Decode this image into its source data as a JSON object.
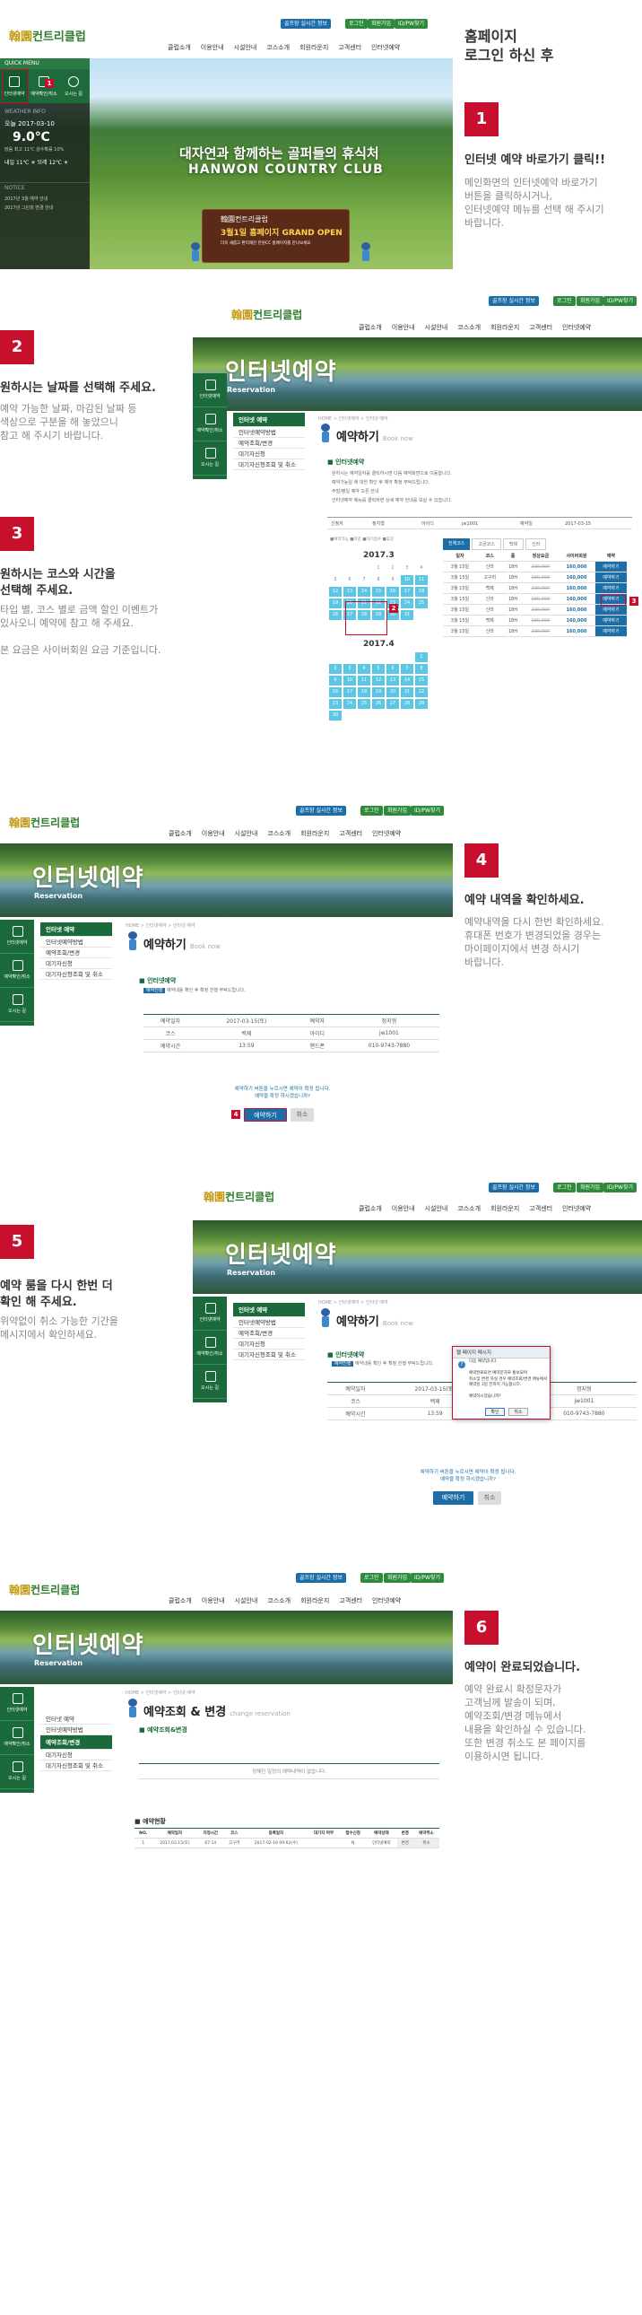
{
  "common": {
    "logo_a": "翰園",
    "logo_b": "컨트리클럽",
    "booking_btn": "골프장 실시간 정보",
    "login": "로그인",
    "join": "회원가입",
    "idpw": "ID/PW찾기",
    "nav": [
      "클럽소개",
      "이용안내",
      "시설안내",
      "코스소개",
      "회원라운지",
      "고객센터",
      "인터넷예약"
    ],
    "quick": [
      "인터넷예약",
      "예약확인/취소",
      "오시는 길"
    ],
    "side_menu": [
      "인터넷 예약",
      "인터넷예약방법",
      "예약조회/변경",
      "대기자신청",
      "대기자신청조회 및 취소"
    ],
    "breadcrumb": "HOME > 인터넷예약 > 인터넷 예약",
    "hero_title": "인터넷예약",
    "hero_sub": "Reservation",
    "mascot_title": "예약하기",
    "mascot_en": "Book now",
    "colors": {
      "red": "#c8102e",
      "green": "#1a6a3c",
      "blue": "#1d6ea8"
    }
  },
  "s1": {
    "quick_menu": "QUICK MENU",
    "weather_info": "WEATHER INFO",
    "date": "오늘 2017-03-10",
    "temp": "9.0℃",
    "weather_line": "맑음  최고 11℃  강수확률 10%",
    "tomorrow": "내일 11℃",
    "after": "모레 12℃",
    "notice": "NOTICE",
    "notice1": "2017년 3월 예약 안내",
    "notice2": "2017년 그린피 변경 안내",
    "hero_ko": "대자연과 함께하는 골퍼들의 휴식처",
    "hero_en": "HANWON COUNTRY CLUB",
    "banner_logo": "翰園컨트리클럽",
    "banner_main": "3월1일 홈페이지 GRAND OPEN",
    "banner_sub": "더욱 새롭고 편리해진 한원CC 홈페이지를 만나보세요",
    "marker": "1",
    "title": "홈페이지\n로그인 하신 후",
    "num": "1",
    "head": "인터넷 예약 바로가기 클릭!!",
    "desc": "메인화면의 인터넷예약 바로가기\n버튼을 클릭하시거나,\n인터넷예약 메뉴를 선택 해 주시기\n바랍니다."
  },
  "s2": {
    "num": "2",
    "head": "원하시는 날짜를 선택해 주세요.",
    "desc": "예약 가능한 날짜, 마감된 날짜 등\n색상으로 구분을 해 놓았으니\n참고 해 주시기 바랍니다.",
    "num3": "3",
    "head3": "원하시는 코스와 시간을\n선택해 주세요.",
    "desc3": "타입 별, 코스 별로 금액 할인 이벤트가\n있사오니 예약에 참고 해 주세요.\n\n본 요금은 사이버회원 요금 기준입니다.",
    "info_head": "인터넷예약",
    "info1": "원하시는 예약일자를 클릭하시면 다음 예약화면으로 이동합니다.",
    "info2": "예약가능일 에 대한 확인 후 예약 확정 부탁드립니다.",
    "info3": "주말/평일 예약 오픈 안내",
    "info4": "인터넷예약 메뉴를 클릭하면 상세 예약 안내를 보실 수 있습니다.",
    "form_labels": [
      "신청자",
      "정지형",
      "아이디",
      "jw1001",
      "예약일",
      "2017-03-15"
    ],
    "cal_title": "2017.3",
    "cal2_title": "2017.4",
    "legend": "■예약가능 ■마감 ■대기접수 ■휴장",
    "tabs": [
      "전체코스",
      "고궁코스",
      "백제",
      "신라"
    ],
    "th": [
      "일자",
      "코스",
      "홀",
      "정상요금",
      "사이버회원",
      "예약"
    ],
    "rows": [
      [
        "3월 15일",
        "신라",
        "18H",
        "230,000",
        "160,000",
        "예약하기"
      ],
      [
        "3월 15일",
        "고구려",
        "18H",
        "230,000",
        "160,000",
        "예약하기"
      ],
      [
        "3월 15일",
        "백제",
        "18H",
        "230,000",
        "160,000",
        "예약하기"
      ],
      [
        "3월 15일",
        "신라",
        "18H",
        "230,000",
        "160,000",
        "예약하기"
      ],
      [
        "3월 15일",
        "신라",
        "18H",
        "230,000",
        "160,000",
        "예약하기"
      ],
      [
        "3월 15일",
        "백제",
        "18H",
        "230,000",
        "160,000",
        "예약하기"
      ],
      [
        "3월 15일",
        "신라",
        "18H",
        "230,000",
        "160,000",
        "예약하기"
      ]
    ],
    "m2": "2",
    "m3": "3"
  },
  "s4": {
    "num": "4",
    "head": "예약 내역을 확인하세요.",
    "desc": "예약내역을 다시 한번 확인하세요.\n휴대폰 번호가 변경되었을 경우는\n마이페이지에서 변경 하시기\n바랍니다.",
    "info_head": "인터넷예약",
    "info_tag": "예약진행",
    "info_text": "예약내용 확인 후 확정 진행 부탁드립니다.",
    "r1": [
      "예약일자",
      "2017-03-15(토)",
      "예약자",
      "정지형"
    ],
    "r2": [
      "코스",
      "백제",
      "아이디",
      "jw1001"
    ],
    "r3": [
      "예약시간",
      "13:59",
      "핸드폰",
      "010-9743-7880"
    ],
    "confirm": "예약하기 버튼을 누르시면 예약이 확정 됩니다.\n예약을 확정 하시겠습니까?",
    "btn_ok": "예약하기",
    "btn_cancel": "취소",
    "marker": "4"
  },
  "s5": {
    "num": "5",
    "head": "예약 룸을 다시 한번 더\n확인 해 주세요.",
    "desc": "위약없이 취소 가능한 기간을\n메시지에서 확인하세요.",
    "dialog_title": "웹 페이지 메시지",
    "dialog_text": "다음 예약입니다.\n\n예약완료되면 예약문자로 통보되며\n취소및 변경 하실 경우 예약조회/변경 메뉴에서\n예약일 3일 전까지 가능합니다.\n\n예약하시겠습니까?",
    "dialog_ok": "확인",
    "dialog_cancel": "취소"
  },
  "s6": {
    "num": "6",
    "head": "예약이 완료되었습니다.",
    "desc": "예약 완료시 확정문자가\n고객님께 발송이 되며,\n예약조회/변경 메뉴에서\n내용을 확인하실 수 있습니다.\n또한 변경 취소도 본 페이지를\n이용하시면 됩니다.",
    "page_title": "예약조회",
    "page_title2": "& 변경",
    "page_en": "change reservation",
    "sub_head": "예약조회&변경",
    "notice": "정해진 일정의 예약내역이 없습니다.",
    "list_head": "예약현황",
    "th": [
      "NO.",
      "예약일자",
      "지정시간",
      "코스",
      "등록일자",
      "대기자 여부",
      "접수신청",
      "예약상태",
      "변경",
      "예약취소"
    ],
    "row": [
      "1",
      "2017.03.15(토)",
      "07:14",
      "고구려",
      "2017-02-16 09:02(수)",
      "",
      "N",
      "인터넷예약",
      "변경",
      "취소"
    ]
  }
}
